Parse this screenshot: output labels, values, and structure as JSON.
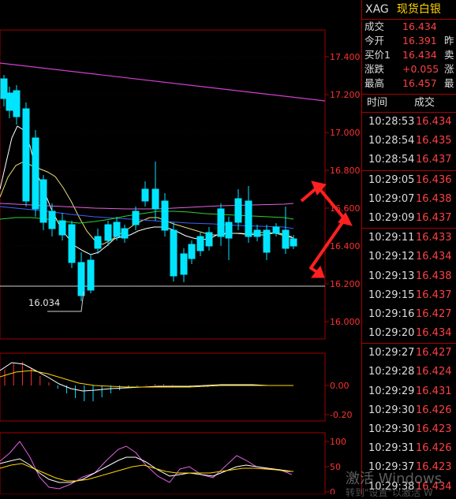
{
  "header": {
    "code": "XAG",
    "name": "现货白银"
  },
  "quote": [
    {
      "label": "成交",
      "value": "16.434",
      "label2": ""
    },
    {
      "label": "今开",
      "value": "16.391",
      "label2": "昨"
    },
    {
      "label": "买价1",
      "value": "16.434",
      "label2": "卖"
    },
    {
      "label": "涨跌",
      "value": "+0.055",
      "label2": "涨"
    },
    {
      "label": "最高",
      "value": "16.457",
      "label2": "最"
    }
  ],
  "ticks_header": {
    "time": "时间",
    "price": "成交"
  },
  "ticks": [
    {
      "time": "10:28:53",
      "price": "16.434"
    },
    {
      "time": "10:28:54",
      "price": "16.435"
    },
    {
      "time": "10:28:54",
      "price": "16.437"
    },
    {
      "time": "10:29:05",
      "price": "16.436"
    },
    {
      "time": "10:29:07",
      "price": "16.438"
    },
    {
      "time": "10:29:09",
      "price": "16.437"
    },
    {
      "time": "10:29:11",
      "price": "16.433"
    },
    {
      "time": "10:29:12",
      "price": "16.434"
    },
    {
      "time": "10:29:13",
      "price": "16.438"
    },
    {
      "time": "10:29:15",
      "price": "16.437"
    },
    {
      "time": "10:29:16",
      "price": "16.427"
    },
    {
      "time": "10:29:20",
      "price": "16.434"
    },
    {
      "time": "10:29:27",
      "price": "16.427"
    },
    {
      "time": "10:29:28",
      "price": "16.424"
    },
    {
      "time": "10:29:29",
      "price": "16.431"
    },
    {
      "time": "10:29:30",
      "price": "16.426"
    },
    {
      "time": "10:29:30",
      "price": "16.423"
    },
    {
      "time": "10:29:31",
      "price": "16.426"
    },
    {
      "time": "10:29:37",
      "price": "16.423"
    },
    {
      "time": "10:29:38",
      "price": "16.434"
    }
  ],
  "main_axis": [
    "17.400",
    "17.200",
    "17.000",
    "16.800",
    "16.600",
    "16.400",
    "16.200",
    "16.000"
  ],
  "low_marker": "16.034",
  "macd_axis": [
    "0.00",
    "-0.20"
  ],
  "kdj_axis": [
    "100",
    "50",
    "0"
  ],
  "watermark": {
    "line1": "激活 Windows",
    "line2": "转到\"设置\"以激活 W"
  },
  "colors": {
    "up": "#ff3030",
    "down": "#00e5ff",
    "grid": "#a00000",
    "accent": "#ffd400"
  }
}
